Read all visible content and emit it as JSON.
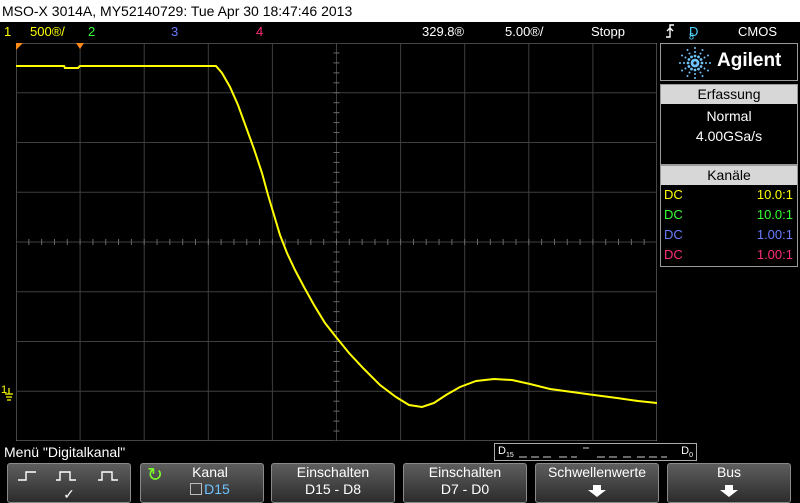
{
  "title": "MSO-X 3014A, MY52140729: Tue Apr 30 18:47:46 2013",
  "status": {
    "ch1_num": "1",
    "ch1_scale": "500®/",
    "ch2_num": "2",
    "ch3_num": "3",
    "ch4_num": "4",
    "time_delay": "329.8®",
    "time_scale": "5.00®/",
    "run_state": "Stopp",
    "trigger_source": "D",
    "trigger_sub": "8",
    "trigger_level": "CMOS"
  },
  "brand": "Agilent",
  "acquisition": {
    "header": "Erfassung",
    "mode": "Normal",
    "rate": "4.00GSa/s"
  },
  "channels": {
    "header": "Kanäle",
    "rows": [
      {
        "coupling": "DC",
        "probe": "10.0:1",
        "color": "#ffff00"
      },
      {
        "coupling": "DC",
        "probe": "10.0:1",
        "color": "#33ff33"
      },
      {
        "coupling": "DC",
        "probe": "1.00:1",
        "color": "#6a7cff"
      },
      {
        "coupling": "DC",
        "probe": "1.00:1",
        "color": "#ff2d7a"
      }
    ]
  },
  "ground_marker": "1",
  "menu_label": "Menü \"Digitalkanal\"",
  "digital_bus": {
    "left": "D",
    "left_sub": "15",
    "right": "D",
    "right_sub": "0"
  },
  "softkeys": [
    {
      "line1": "",
      "line2": "✓"
    },
    {
      "line1": "Kanal",
      "line2": "D15"
    },
    {
      "line1": "Einschalten",
      "line2": "D15 - D8"
    },
    {
      "line1": "Einschalten",
      "line2": "D7 - D0"
    },
    {
      "line1": "Schwellenwerte",
      "line2": ""
    },
    {
      "line1": "Bus",
      "line2": ""
    }
  ],
  "colors": {
    "ch1": "#ffff00",
    "ch2": "#33ff33",
    "ch3": "#6a7cff",
    "ch4": "#ff2d7a",
    "trigger_marker": "#ff8c1a"
  }
}
